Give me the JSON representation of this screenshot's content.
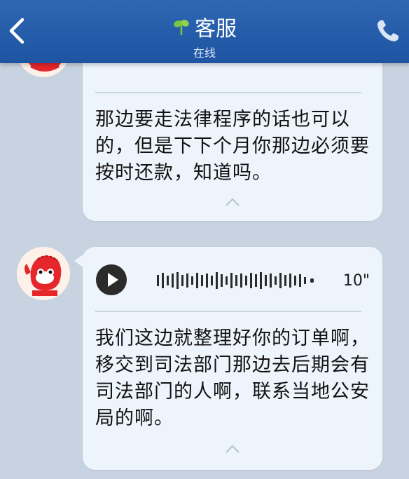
{
  "header": {
    "title": "客服",
    "status": "在线",
    "back_icon": "chevron-left-icon",
    "phone_icon": "phone-icon",
    "colors": {
      "bar": "#2460ad",
      "text": "#ffffff"
    }
  },
  "messages": [
    {
      "text": "那边要走法律程序的话也可以的，但是下下个月你那边必须要按时还款，知道吗。",
      "duration": ""
    },
    {
      "text": "我们这边就整理好你的订单啊，移交到司法部门那边去后期会有司法部门的人啊，联系当地公安局的啊。",
      "duration": "10\""
    }
  ],
  "colors": {
    "background": "#c8d3e1",
    "bubble": "#eef4fc"
  }
}
